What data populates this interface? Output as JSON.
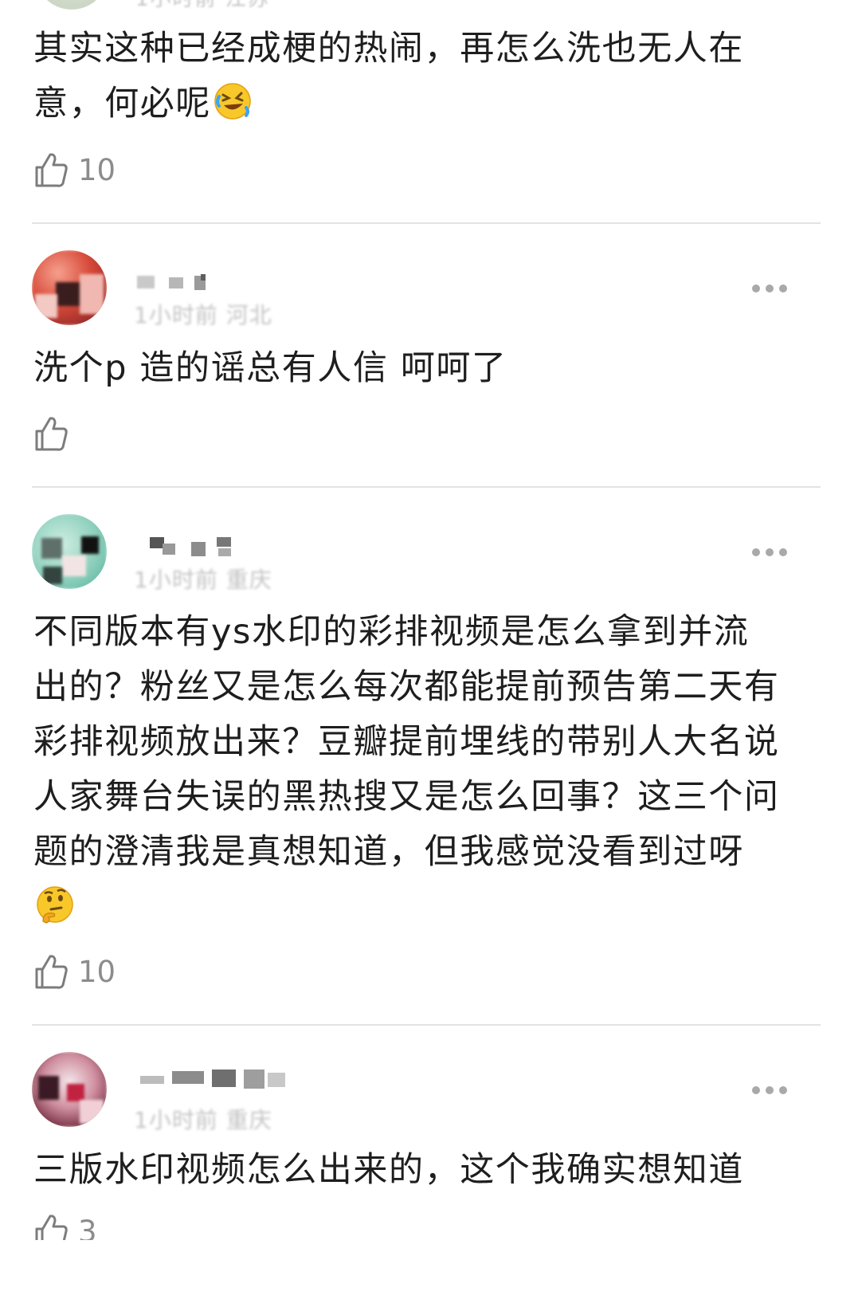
{
  "comments": [
    {
      "text": "其实这种已经成梗的热闹，再怎么洗也无人在意，何必呢",
      "emoji": "rolling-on-floor-laughing-emoji",
      "likes": "10"
    },
    {
      "text": "洗个p  造的谣总有人信 呵呵了",
      "likes": ""
    },
    {
      "text": "不同版本有ys水印的彩排视频是怎么拿到并流出的？粉丝又是怎么每次都能提前预告第二天有彩排视频放出来？豆瓣提前埋线的带别人大名说人家舞台失误的黑热搜又是怎么回事？这三个问题的澄清我是真想知道，但我感觉没看到过呀",
      "emoji": "thinking-face-emoji",
      "likes": "10"
    },
    {
      "text": "三版水印视频怎么出来的，这个我确实想知道",
      "likes": "3"
    }
  ],
  "icons": {
    "like": "thumbs-up-outline-icon",
    "more": "more-dots-icon"
  },
  "colors": {
    "text": "#1e1e1e",
    "meta": "#8c8c8c",
    "divider": "#e3e3e3",
    "dots": "#a9a9a9"
  }
}
